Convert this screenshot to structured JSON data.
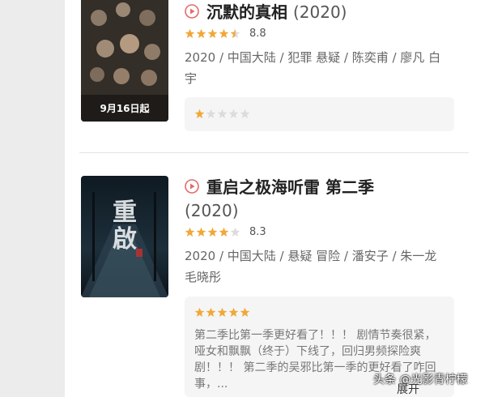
{
  "colors": {
    "accent": "#e26b6b",
    "star": "#f1a838",
    "star_empty": "#dcdcdc"
  },
  "items": [
    {
      "poster_caption": "9月16日起",
      "title_text": "沉默的真相",
      "year": "(2020)",
      "rating_stars": 4.5,
      "score": "8.8",
      "meta": "2020 / 中国大陆 / 犯罪 悬疑 / 陈奕甫 / 廖凡 白宇",
      "comment_rating_stars": 1,
      "comment": ""
    },
    {
      "poster_caption": "",
      "title_text": "重启之极海听雷 第二季",
      "year": "(2020)",
      "rating_stars": 4,
      "score": "8.3",
      "meta": "2020 / 中国大陆 / 悬疑 冒险 / 潘安子 / 朱一龙 毛晓彤",
      "comment_rating_stars": 5,
      "comment": "第二季比第一季更好看了！！！ 剧情节奏很紧，哑女和飘飘（终于）下线了，回归男频探险爽剧！！！ 第二季的吴邪比第一季的更好看了咋回事，..."
    }
  ],
  "expand_label": "展开",
  "watermark": "头条 @光影青柠檬"
}
